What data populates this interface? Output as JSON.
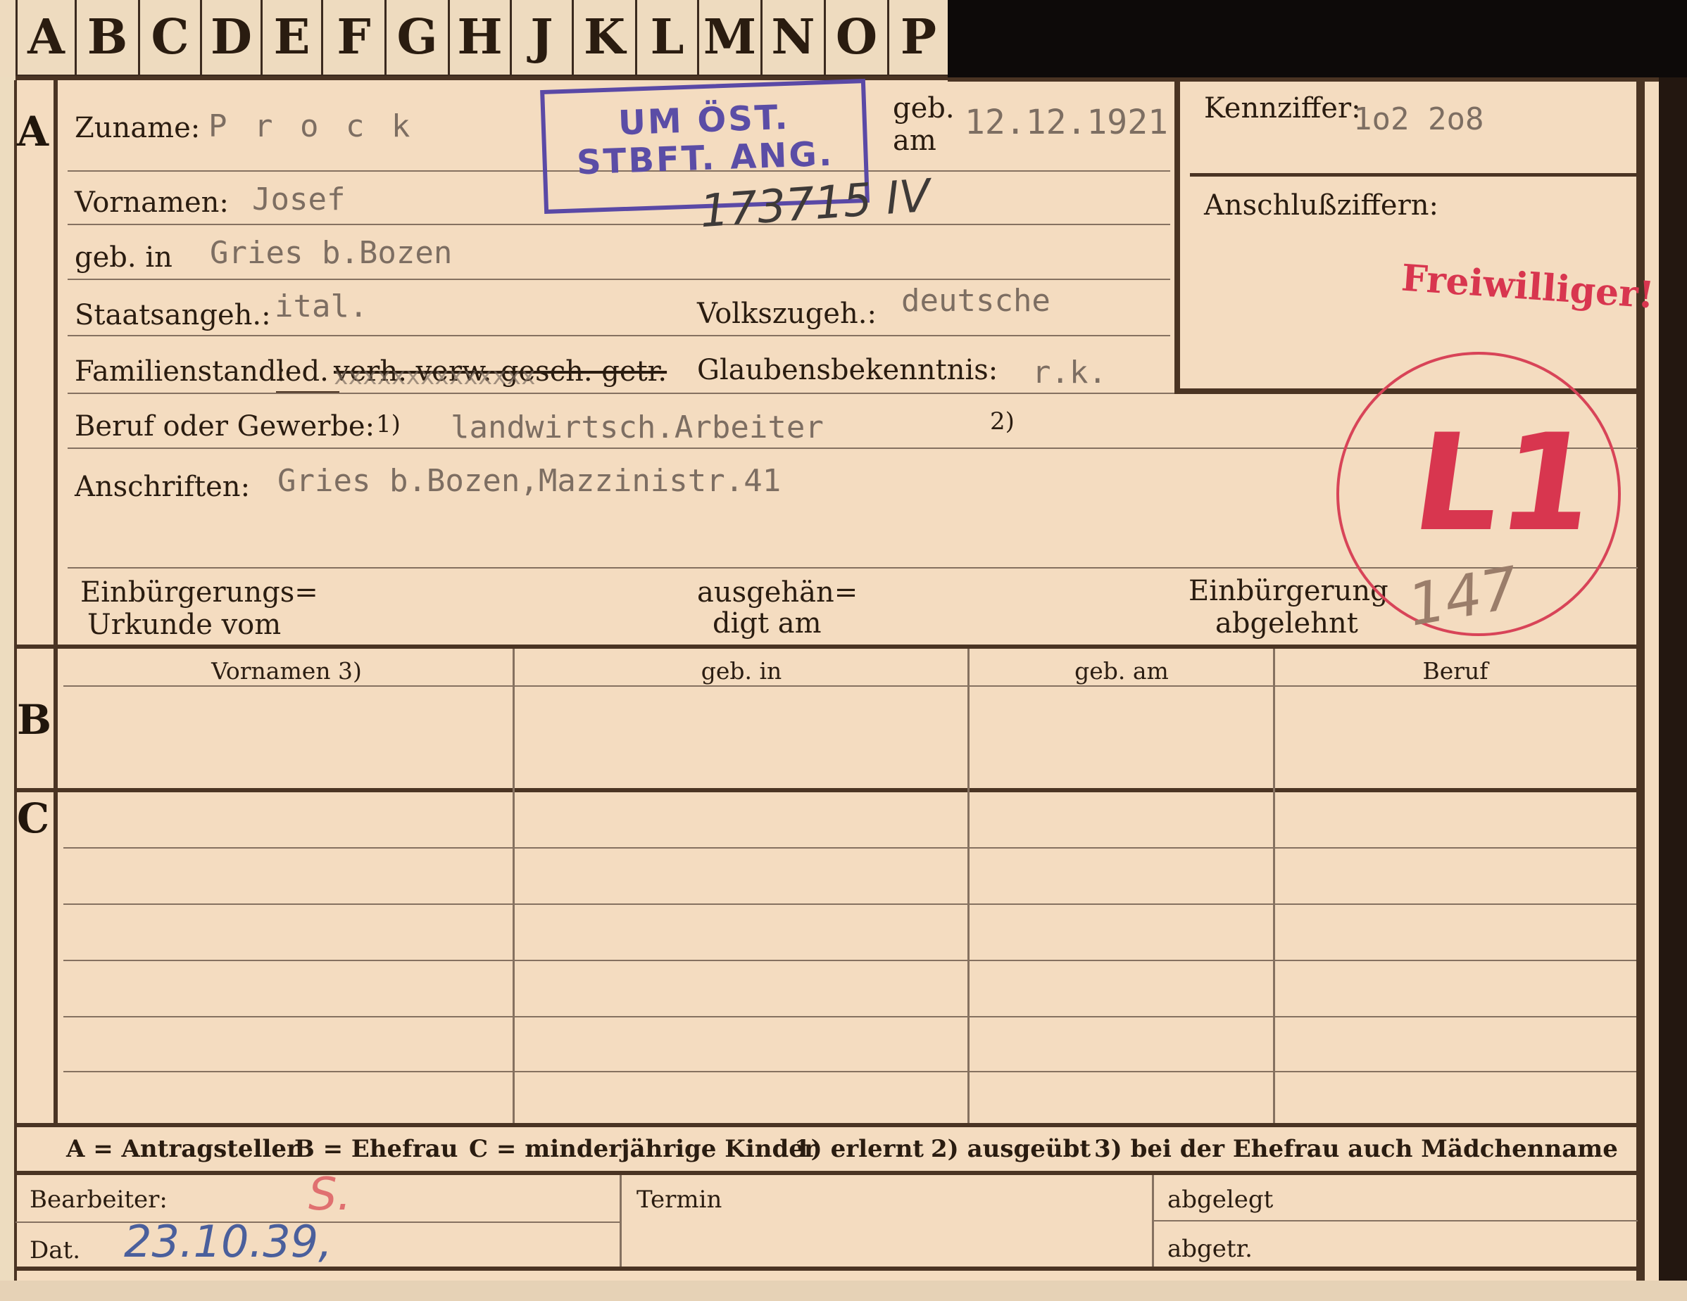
{
  "tabs": [
    "A",
    "B",
    "C",
    "D",
    "E",
    "F",
    "G",
    "H",
    "J",
    "K",
    "L",
    "M",
    "N",
    "O",
    "P"
  ],
  "sections": {
    "a": "A",
    "b": "B",
    "c": "C"
  },
  "fields": {
    "zuname_label": "Zuname:",
    "zuname_value": "P r o c k",
    "geb_am_label_1": "geb.",
    "geb_am_label_2": "am",
    "geb_am_value": "12.12.1921",
    "kennziffer_label": "Kennziffer:",
    "kennziffer_value": "1o2 2o8",
    "vornamen_label": "Vornamen:",
    "vornamen_value": "Josef",
    "anschlussziffern_label": "Anschlußziffern:",
    "geb_in_label": "geb. in",
    "geb_in_value": "Gries b.Bozen",
    "staatsangeh_label": "Staatsangeh.:",
    "staatsangeh_value": "ital.",
    "volkszugeh_label": "Volkszugeh.:",
    "volkszugeh_value": "deutsche",
    "familienstand_label": "Familienstand:",
    "familienstand_options_selected": "led.",
    "familienstand_options_struck": "verh. verw. gesch. getr.",
    "familienstand_xs": "xxxxxxxxxxxxxx",
    "glaubens_label": "Glaubensbekenntnis:",
    "glaubens_value": "r.k.",
    "beruf_label": "Beruf oder Gewerbe:",
    "beruf_note_1": "1)",
    "beruf_value": "landwirtsch.Arbeiter",
    "beruf_note_2": "2)",
    "anschriften_label": "Anschriften:",
    "anschriften_value": "Gries b.Bozen,Mazzinistr.41",
    "einbuergerung_label_1": "Einbürgerungs=",
    "einbuergerung_label_2": "Urkunde vom",
    "ausgehaendigt_1": "ausgehän=",
    "ausgehaendigt_2": "digt am",
    "abgelehnt_1": "Einbürgerung",
    "abgelehnt_2": "abgelehnt"
  },
  "stamp": {
    "line1": "UM ÖST.",
    "line2": "STBFT. ANG."
  },
  "annotations": {
    "freiwilliger": "Freiwilliger!",
    "circle_letter": "L1",
    "circle_number": "147",
    "handwritten_ref": "173715 IV",
    "bearbeiter_value": "S.",
    "dat_value": "23.10.39,"
  },
  "table_headers": [
    "Vornamen 3)",
    "geb. in",
    "geb. am",
    "Beruf"
  ],
  "legend": {
    "a": "A = Antragsteller",
    "b": "B = Ehefrau",
    "c": "C = minderjährige Kinder",
    "n1": "1) erlernt",
    "n2": "2) ausgeübt",
    "n3": "3) bei der Ehefrau auch Mädchenname"
  },
  "footer": {
    "bearbeiter_label": "Bearbeiter:",
    "dat_label": "Dat.",
    "termin_label": "Termin",
    "abgelegt_label": "abgelegt",
    "abgetr_label": "abgetr."
  },
  "colors": {
    "ink": "#2a1c10",
    "typed": "#7d6e62",
    "stamp": "#5a49a6",
    "red": "#d84458",
    "pen": "#4a5f9c"
  }
}
